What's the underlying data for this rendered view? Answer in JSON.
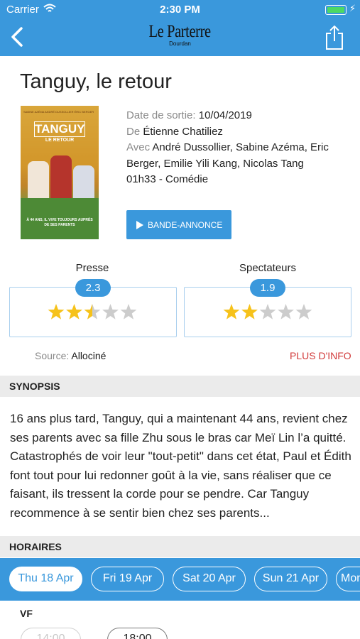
{
  "status_bar": {
    "carrier": "Carrier",
    "time": "2:30 PM"
  },
  "nav": {
    "logo_title": "Le Parterre",
    "logo_subtitle": "Dourdan",
    "back_icon": "chevron-left-icon",
    "share_icon": "share-icon"
  },
  "movie": {
    "title": "Tanguy, le retour",
    "poster": {
      "credits": "SABINE AZÉMA   ANDRÉ DUSSOLLIER   ÉRIC BERGER",
      "title": "TANGUY",
      "subtitle": "LE RETOUR",
      "caption": "À 44 ANS, IL VIVE TOUJOURS AUPRÈS DE SES PARENTS"
    },
    "release_label": "Date de sortie:",
    "release_date": "10/04/2019",
    "director_label": "De",
    "director": "Étienne Chatiliez",
    "cast_label": "Avec",
    "cast": "André Dussollier, Sabine Azéma, Eric Berger, Emilie Yili Kang, Nicolas Tang",
    "duration_genre": "01h33 - Comédie",
    "trailer_button": "BANDE-ANNONCE"
  },
  "ratings": {
    "press": {
      "label": "Presse",
      "score": "2.3",
      "stars": 2.5
    },
    "audience": {
      "label": "Spectateurs",
      "score": "1.9",
      "stars": 2
    },
    "source_label": "Source:",
    "source": "Allociné",
    "more_info": "PLUS D'INFO"
  },
  "synopsis": {
    "header": "SYNOPSIS",
    "text": "16 ans plus tard, Tanguy, qui a maintenant 44 ans, revient chez ses parents avec sa fille Zhu sous le bras car Meï Lin l’a quitté. Catastrophés de voir leur \"tout-petit\" dans cet état, Paul et Édith font tout pour lui redonner goût à la vie, sans réaliser que ce faisant, ils tressent la corde pour se pendre. Car Tanguy recommence à se sentir bien chez ses parents..."
  },
  "schedule": {
    "header": "HORAIRES",
    "days": [
      "Thu 18 Apr",
      "Fri 19 Apr",
      "Sat 20 Apr",
      "Sun 21 Apr",
      "Mon"
    ],
    "active_day": 0,
    "version": "VF",
    "showtimes": [
      "14:00",
      "18:00"
    ]
  },
  "colors": {
    "accent": "#3a98dc",
    "link_red": "#d13a3a",
    "star": "#f6c21a",
    "star_empty": "#cccccc"
  }
}
